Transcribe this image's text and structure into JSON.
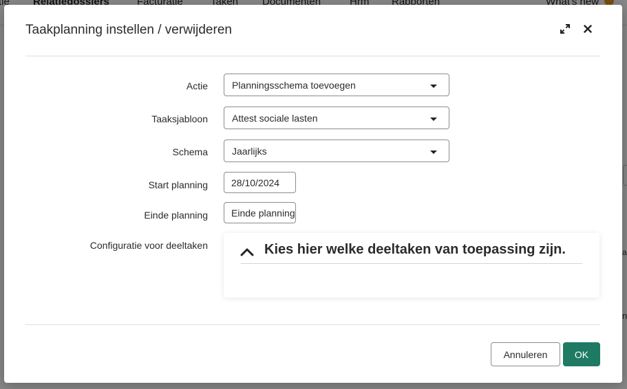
{
  "background": {
    "nav": [
      "tie",
      "Relatiedossiers",
      "Facturatie",
      "Taken",
      "Documenten",
      "Hrm",
      "Rapporten",
      "What's new"
    ],
    "active_nav": "Relatiedossiers"
  },
  "modal": {
    "title": "Taakplanning instellen / verwijderen",
    "expand_icon": "expand-icon",
    "close_icon": "close-icon"
  },
  "form": {
    "actie": {
      "label": "Actie",
      "value": "Planningsschema toevoegen"
    },
    "taaksjabloon": {
      "label": "Taaksjabloon",
      "value": "Attest sociale lasten"
    },
    "schema": {
      "label": "Schema",
      "value": "Jaarlijks"
    },
    "start_planning": {
      "label": "Start planning",
      "value": "28/10/2024"
    },
    "einde_planning": {
      "label": "Einde planning",
      "placeholder": "Einde planning"
    },
    "configuratie": {
      "label": "Configuratie voor deeltaken"
    }
  },
  "subtasks": {
    "heading": "Kies hier welke deeltaken van toepassing zijn.",
    "toggle_icon": "chevron-up-icon"
  },
  "footer": {
    "cancel_label": "Annuleren",
    "ok_label": "OK"
  },
  "colors": {
    "primary": "#1f7a63",
    "overlay": "rgba(0,0,0,0.47)",
    "badge": "#e8901f"
  }
}
